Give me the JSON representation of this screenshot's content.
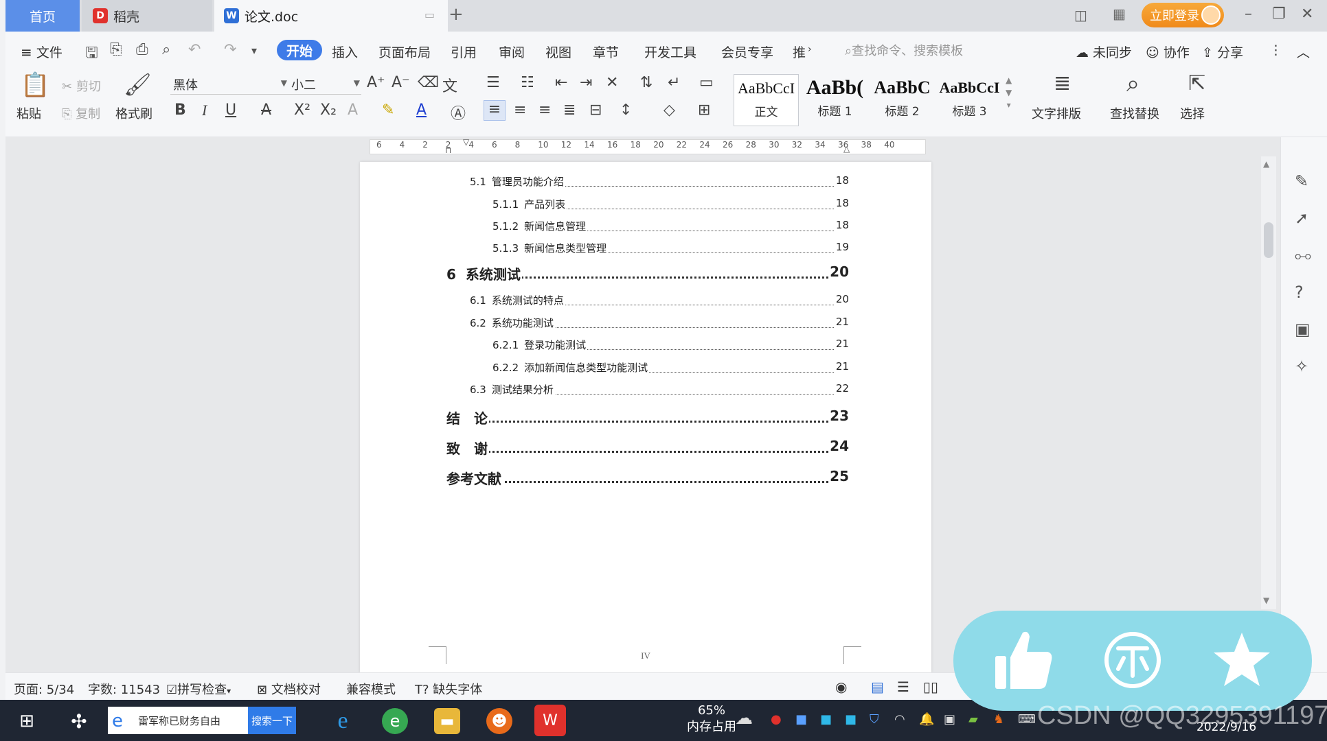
{
  "tabs": {
    "home": "首页",
    "daoke": "稻壳",
    "doc": "论文.doc"
  },
  "titlebar": {
    "login": "立即登录"
  },
  "menubar": {
    "file": "文件",
    "items": [
      "开始",
      "插入",
      "页面布局",
      "引用",
      "审阅",
      "视图",
      "章节",
      "开发工具",
      "会员专享",
      "推"
    ],
    "search_placeholder": "查找命令、搜索模板",
    "sync": "未同步",
    "collab": "协作",
    "share": "分享"
  },
  "ribbon": {
    "paste": "粘贴",
    "cut": "剪切",
    "copy": "复制",
    "format_painter": "格式刷",
    "font": "黑体",
    "font_size": "小二",
    "styles": [
      {
        "sample": "AaBbCcI",
        "name": "正文"
      },
      {
        "sample": "AaBb(",
        "name": "标题 1"
      },
      {
        "sample": "AaBbC",
        "name": "标题 2"
      },
      {
        "sample": "AaBbCcI",
        "name": "标题 3"
      }
    ],
    "text_layout": "文字排版",
    "find_replace": "查找替换",
    "select": "选择"
  },
  "ruler": {
    "ticks": [
      "6",
      "4",
      "2",
      "2",
      "4",
      "6",
      "8",
      "10",
      "12",
      "14",
      "16",
      "18",
      "20",
      "22",
      "24",
      "26",
      "28",
      "30",
      "32",
      "34",
      "36",
      "38",
      "40"
    ]
  },
  "toc": [
    {
      "level": 2,
      "num": "5.1",
      "title": "管理员功能介绍",
      "page": "18"
    },
    {
      "level": 3,
      "num": "5.1.1",
      "title": "产品列表",
      "page": "18"
    },
    {
      "level": 3,
      "num": "5.1.2",
      "title": "新闻信息管理",
      "page": "18"
    },
    {
      "level": 3,
      "num": "5.1.3",
      "title": "新闻信息类型管理",
      "page": "19"
    },
    {
      "level": 1,
      "num": "6",
      "title": "系统测试",
      "page": "20"
    },
    {
      "level": 2,
      "num": "6.1",
      "title": "系统测试的特点",
      "page": "20"
    },
    {
      "level": 2,
      "num": "6.2",
      "title": "系统功能测试",
      "page": "21"
    },
    {
      "level": 3,
      "num": "6.2.1",
      "title": "登录功能测试",
      "page": "21"
    },
    {
      "level": 3,
      "num": "6.2.2",
      "title": "添加新闻信息类型功能测试",
      "page": "21"
    },
    {
      "level": 2,
      "num": "6.3",
      "title": "测试结果分析",
      "page": "22"
    },
    {
      "level": 1,
      "num": "",
      "title": "结　论",
      "page": "23"
    },
    {
      "level": 1,
      "num": "",
      "title": "致　谢",
      "page": "24"
    },
    {
      "level": 1,
      "num": "",
      "title": "参考文献",
      "page": "25"
    }
  ],
  "page_footer": "IV",
  "statusbar": {
    "page": "页面: 5/34",
    "words": "字数: 11543",
    "spell": "拼写检查",
    "proof": "文档校对",
    "compat": "兼容模式",
    "missing_font": "缺失字体"
  },
  "taskbar": {
    "search_text": "雷军称已财务自由",
    "search_btn": "搜索一下",
    "mem_percent": "65%",
    "mem_label": "内存占用",
    "date": "2022/9/16"
  },
  "overlay": {
    "watermark": "CSDN @QQ3295391197"
  },
  "colors": {
    "accent": "#3e7be8",
    "login": "#f39a2a",
    "overlay": "#8fdbe9",
    "taskbar": "#1f2633"
  }
}
